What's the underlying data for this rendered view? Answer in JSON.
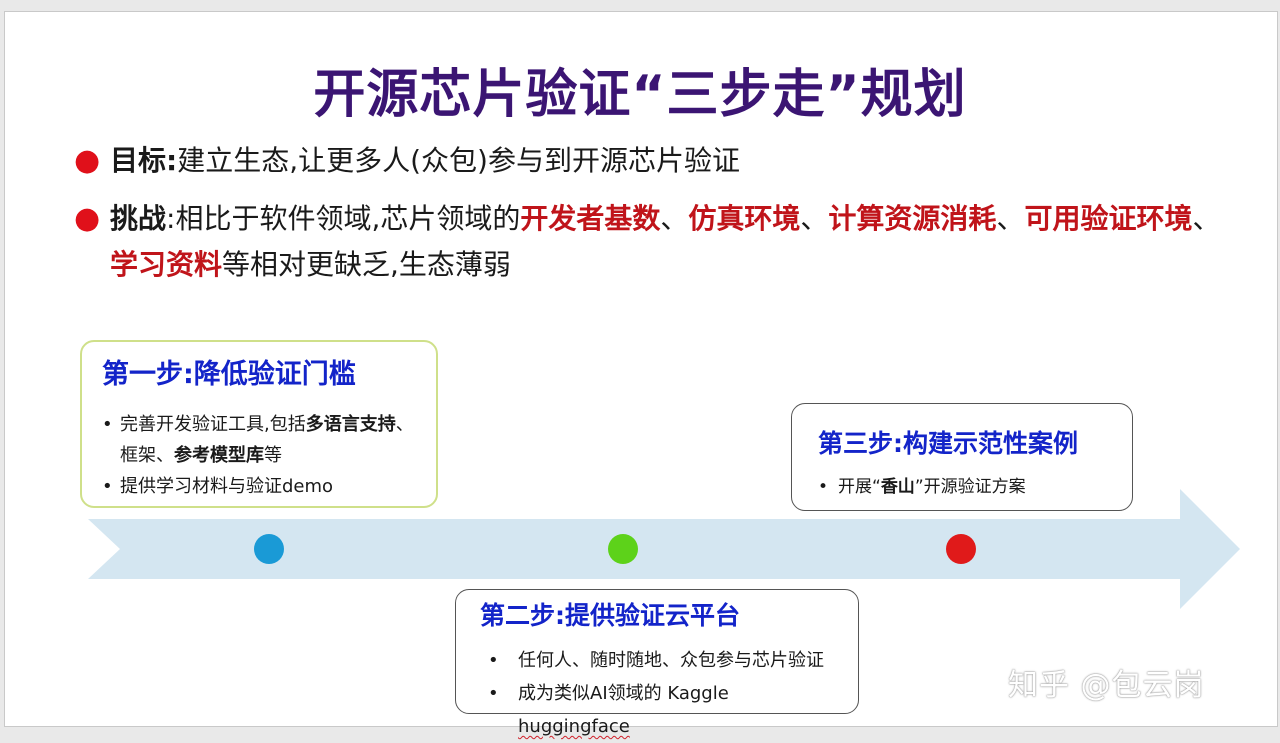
{
  "slide": {
    "title": "开源芯片验证“三步走”规划",
    "bullets": {
      "goal": {
        "label": "目标:",
        "text": "建立生态,让更多人(众包)参与到开源芯片验证"
      },
      "challenge": {
        "label": "挑战",
        "sep": ":",
        "t1": "相比于软件领域,芯片领域的",
        "h1": "开发者基数",
        "s1": "、",
        "h2": "仿真环境",
        "s2": "、",
        "h3": "计算资源消耗",
        "s3": "、",
        "h4": "可用验证环境",
        "s4": "、",
        "h5": "学习资料",
        "t2": "等相对更缺乏,生态薄弱"
      }
    },
    "steps": {
      "step1": {
        "title": "第一步:降低验证门槛",
        "items": {
          "i1_a": "完善开发验证工具,包括",
          "i1_b": "多语言支持",
          "i1_c": "、框架、",
          "i1_d": "参考模型库",
          "i1_e": "等",
          "i2": "提供学习材料与验证demo"
        }
      },
      "step2": {
        "title": "第二步:提供验证云平台",
        "items": {
          "i1": "任何人、随时随地、众包参与芯片验证",
          "i2_a": "成为类似AI领域的 Kaggle ",
          "i2_b": "huggingface"
        }
      },
      "step3": {
        "title": "第三步:构建示范性案例",
        "items": {
          "i1_a": "开展“",
          "i1_b": "香山",
          "i1_c": "”开源验证方案"
        }
      }
    },
    "timeline": {
      "markers": [
        {
          "name": "step1",
          "color": "#1a9ad6"
        },
        {
          "name": "step2",
          "color": "#5dd21a"
        },
        {
          "name": "step3",
          "color": "#e01a1a"
        }
      ],
      "arrow_color": "#d4e6f1"
    },
    "watermark": "知乎 @包云岗"
  }
}
